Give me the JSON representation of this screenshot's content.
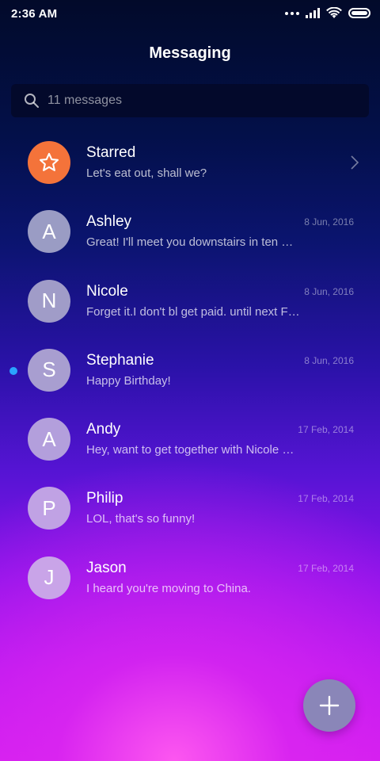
{
  "status_bar": {
    "time": "2:36 AM"
  },
  "header": {
    "title": "Messaging"
  },
  "search": {
    "placeholder": "11 messages"
  },
  "conversations": [
    {
      "name": "Starred",
      "preview": "Let's eat out, shall we?",
      "date": "",
      "avatar": "star-icon",
      "avatar_color": "#f4733a",
      "unread": false,
      "has_chevron": true
    },
    {
      "name": "Ashley",
      "preview": "Great! I'll meet you downstairs in ten …",
      "date": "8 Jun, 2016",
      "avatar": "A",
      "avatar_color": "#9a9cc4",
      "unread": false
    },
    {
      "name": "Nicole",
      "preview": "Forget it.I don't bl get paid. until next F…",
      "date": "8 Jun, 2016",
      "avatar": "N",
      "avatar_color": "#a09cc8",
      "unread": false
    },
    {
      "name": "Stephanie",
      "preview": "Happy Birthday!",
      "date": "8 Jun, 2016",
      "avatar": "S",
      "avatar_color": "#a89ed0",
      "unread": true
    },
    {
      "name": "Andy",
      "preview": "Hey, want to get together with Nicole …",
      "date": "17 Feb, 2014",
      "avatar": "A",
      "avatar_color": "#b39fdc",
      "unread": false
    },
    {
      "name": "Philip",
      "preview": "LOL, that's so funny!",
      "date": "17 Feb, 2014",
      "avatar": "P",
      "avatar_color": "#c0a2e4",
      "unread": false
    },
    {
      "name": "Jason",
      "preview": "I heard you're moving to China.",
      "date": "17 Feb, 2014",
      "avatar": "J",
      "avatar_color": "#c9a4e8",
      "unread": false
    }
  ],
  "fab": {
    "icon": "plus-icon"
  }
}
